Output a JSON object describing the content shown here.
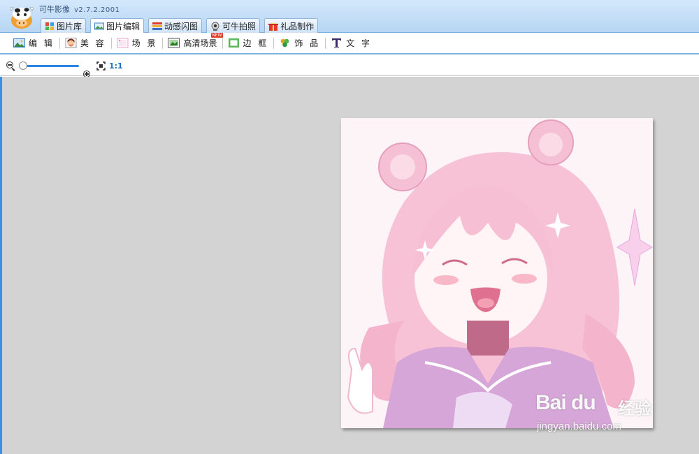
{
  "app": {
    "name": "可牛影像",
    "version": "v2.7.2.2001"
  },
  "main_tabs": [
    {
      "label": "图片库",
      "icon": "gallery-icon",
      "active": false
    },
    {
      "label": "图片编辑",
      "icon": "image-edit-icon",
      "active": true
    },
    {
      "label": "动感闪图",
      "icon": "flash-gif-icon",
      "active": false
    },
    {
      "label": "可牛拍照",
      "icon": "webcam-icon",
      "active": false
    },
    {
      "label": "礼品制作",
      "icon": "gift-icon",
      "active": false
    }
  ],
  "sub_toolbar": [
    {
      "label": "编 辑",
      "icon": "landscape-icon"
    },
    {
      "label": "美 容",
      "icon": "face-icon"
    },
    {
      "label": "场 景",
      "icon": "scene-icon"
    },
    {
      "label": "高清场景",
      "icon": "hd-scene-icon",
      "badge": "NEW"
    },
    {
      "label": "边 框",
      "icon": "frame-icon"
    },
    {
      "label": "饰 品",
      "icon": "clover-icon"
    },
    {
      "label": "文 字",
      "icon": "text-t-icon"
    }
  ],
  "zoom": {
    "level": 0,
    "actual_size_label": "1:1"
  },
  "watermark": {
    "brand": "Bai du",
    "brand_cn": "经验",
    "url": "jingyan.baidu.com"
  },
  "colors": {
    "accent": "#3a8fe0",
    "workspace_bg": "#d3d3d3",
    "photo_pink": "#f4b6cf"
  }
}
